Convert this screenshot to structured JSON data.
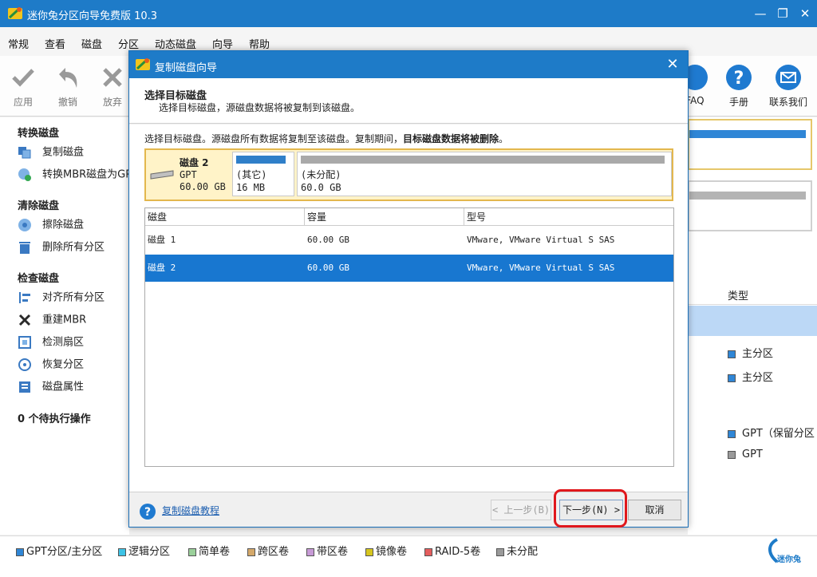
{
  "app": {
    "title": "迷你兔分区向导免费版 10.3"
  },
  "menu": [
    "常规",
    "查看",
    "磁盘",
    "分区",
    "动态磁盘",
    "向导",
    "帮助"
  ],
  "toolbar": {
    "apply": "应用",
    "undo": "撤销",
    "discard": "放弃",
    "faq": "FAQ",
    "manual": "手册",
    "contact": "联系我们"
  },
  "sidebar": {
    "convert_head": "转换磁盘",
    "copy_disk": "复制磁盘",
    "mbr_to_gpt": "转换MBR磁盘为GPT",
    "clean_head": "清除磁盘",
    "wipe_disk": "擦除磁盘",
    "delete_all": "删除所有分区",
    "check_head": "检查磁盘",
    "align_all": "对齐所有分区",
    "rebuild_mbr": "重建MBR",
    "surface_test": "检测扇区",
    "recover_partition": "恢复分区",
    "disk_properties": "磁盘属性",
    "pending": "0 个待执行操作"
  },
  "background": {
    "type_header": "类型",
    "types": [
      "主分区",
      "主分区",
      "GPT（保留分区",
      "GPT"
    ],
    "type_colors": [
      "#2f86d6",
      "#2f86d6",
      "#2f86d6",
      "#9a9a9a"
    ]
  },
  "dialog": {
    "title": "复制磁盘向导",
    "header_title": "选择目标磁盘",
    "header_sub": "选择目标磁盘，源磁盘数据将被复制到该磁盘。",
    "notice_prefix": "选择目标磁盘。源磁盘所有数据将复制至该磁盘。复制期间，",
    "notice_bold": "目标磁盘数据将被删除",
    "notice_suffix": "。",
    "disk_map": {
      "name": "磁盘 2",
      "style": "GPT",
      "size": "60.00 GB",
      "partitions": [
        {
          "label": "(其它)",
          "size": "16 MB",
          "bar_color": "#2f7fc9"
        },
        {
          "label": "(未分配)",
          "size": "60.0 GB",
          "bar_color": "#a9a9a9"
        }
      ]
    },
    "table": {
      "columns": [
        "磁盘",
        "容量",
        "型号"
      ],
      "rows": [
        {
          "disk": "磁盘 1",
          "capacity": "60.00 GB",
          "model": "VMware, VMware Virtual S SAS",
          "selected": false
        },
        {
          "disk": "磁盘 2",
          "capacity": "60.00 GB",
          "model": "VMware, VMware Virtual S SAS",
          "selected": true
        }
      ]
    },
    "help_link": "复制磁盘教程",
    "buttons": {
      "back": "< 上一步(B)",
      "next": "下一步(N) >",
      "cancel": "取消"
    }
  },
  "legend": [
    {
      "label": "GPT分区/主分区",
      "color": "#2f86d6"
    },
    {
      "label": "逻辑分区",
      "color": "#3dc3e6"
    },
    {
      "label": "简单卷",
      "color": "#9ad09a"
    },
    {
      "label": "跨区卷",
      "color": "#d4a86a"
    },
    {
      "label": "带区卷",
      "color": "#c79ad6"
    },
    {
      "label": "镜像卷",
      "color": "#d6c61f"
    },
    {
      "label": "RAID-5卷",
      "color": "#e45d5d"
    },
    {
      "label": "未分配",
      "color": "#9a9a9a"
    }
  ],
  "brand": "迷你兔"
}
